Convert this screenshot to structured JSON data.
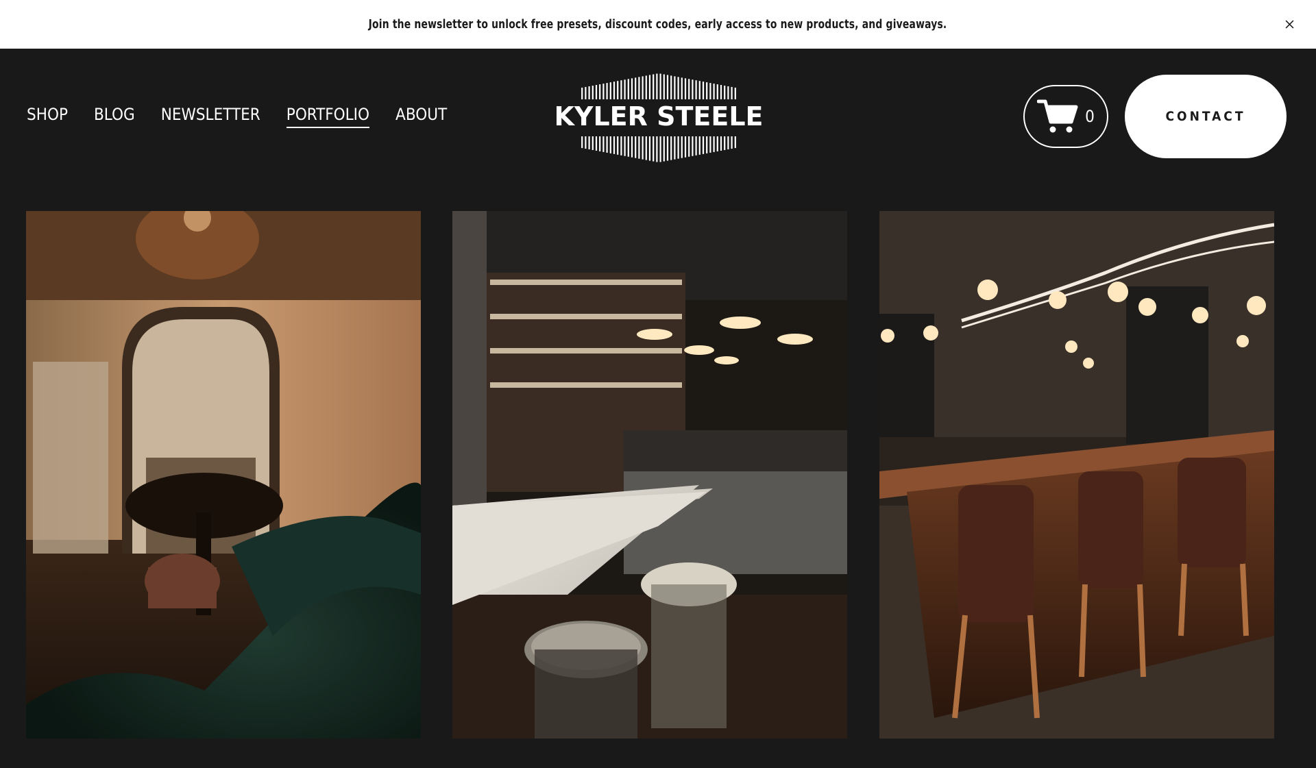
{
  "announcement": {
    "text": "Join the newsletter to unlock free presets, discount codes, early access to new products, and giveaways.",
    "close_icon": "close-icon"
  },
  "nav": {
    "items": [
      {
        "label": "SHOP",
        "active": false
      },
      {
        "label": "BLOG",
        "active": false
      },
      {
        "label": "NEWSLETTER",
        "active": false
      },
      {
        "label": "PORTFOLIO",
        "active": true
      },
      {
        "label": "ABOUT",
        "active": false
      }
    ]
  },
  "logo": {
    "text": "KYLER STEELE"
  },
  "cart": {
    "icon": "cart-icon",
    "count": "0"
  },
  "contact": {
    "label": "CONTACT"
  },
  "colors": {
    "background": "#191919",
    "announcement_bg": "#ffffff",
    "text_light": "#ffffff",
    "text_dark": "#1a1a1a"
  },
  "gallery": {
    "photos": [
      {
        "subject": "restaurant-booth-photo"
      },
      {
        "subject": "deli-counter-photo"
      },
      {
        "subject": "dining-bar-photo"
      }
    ]
  }
}
